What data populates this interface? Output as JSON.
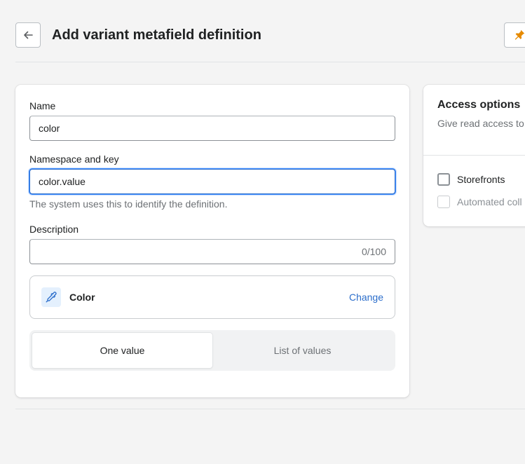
{
  "header": {
    "title": "Add variant metafield definition",
    "back_icon": "arrow-left-icon",
    "pin_icon": "pin-icon",
    "pin_color": "#e68a00"
  },
  "form": {
    "name_label": "Name",
    "name_value": "color",
    "namespace_label": "Namespace and key",
    "namespace_value": "color.value",
    "namespace_help": "The system uses this to identify the definition.",
    "description_label": "Description",
    "description_value": "",
    "description_counter": "0/100",
    "type": {
      "icon": "eyedropper-icon",
      "name": "Color",
      "change_label": "Change"
    },
    "value_options": {
      "one": "One value",
      "list": "List of values",
      "selected": "One value"
    }
  },
  "access": {
    "title": "Access options",
    "description": "Give read access to options.",
    "options": [
      {
        "label": "Storefronts",
        "checked": false,
        "disabled": false
      },
      {
        "label": "Automated coll",
        "checked": false,
        "disabled": true
      }
    ]
  },
  "colors": {
    "accent": "#2c6ecb",
    "background": "#f4f4f4"
  }
}
